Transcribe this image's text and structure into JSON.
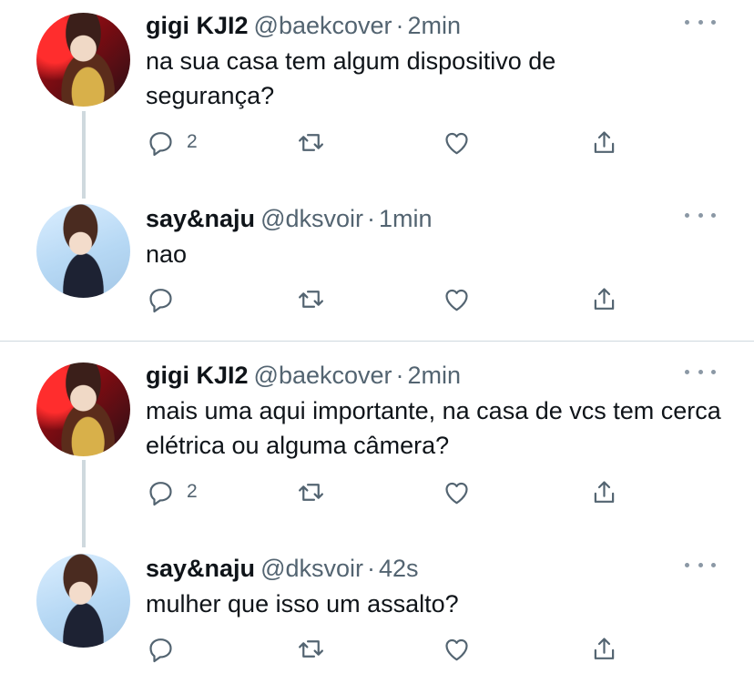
{
  "icons": {
    "reply": "reply-icon",
    "retweet": "retweet-icon",
    "like": "heart-icon",
    "share": "share-icon",
    "more": "more-icon"
  },
  "colors": {
    "icon_gray": "#536471",
    "divider": "#cfd9de",
    "text": "#0f1419"
  },
  "tweets": [
    {
      "display_name": "gigi KJI2",
      "handle": "@baekcover",
      "separator": "·",
      "time": "2min",
      "text": "na sua casa tem algum dispositivo de segurança?",
      "reply_count": "2"
    },
    {
      "display_name": "say&naju",
      "handle": "@dksvoir",
      "separator": "·",
      "time": "1min",
      "text": "nao",
      "reply_count": ""
    },
    {
      "display_name": "gigi KJI2",
      "handle": "@baekcover",
      "separator": "·",
      "time": "2min",
      "text": "mais uma aqui importante, na casa de vcs tem cerca elétrica ou alguma câmera?",
      "reply_count": "2"
    },
    {
      "display_name": "say&naju",
      "handle": "@dksvoir",
      "separator": "·",
      "time": "42s",
      "text": "mulher que isso um assalto?",
      "reply_count": ""
    }
  ]
}
